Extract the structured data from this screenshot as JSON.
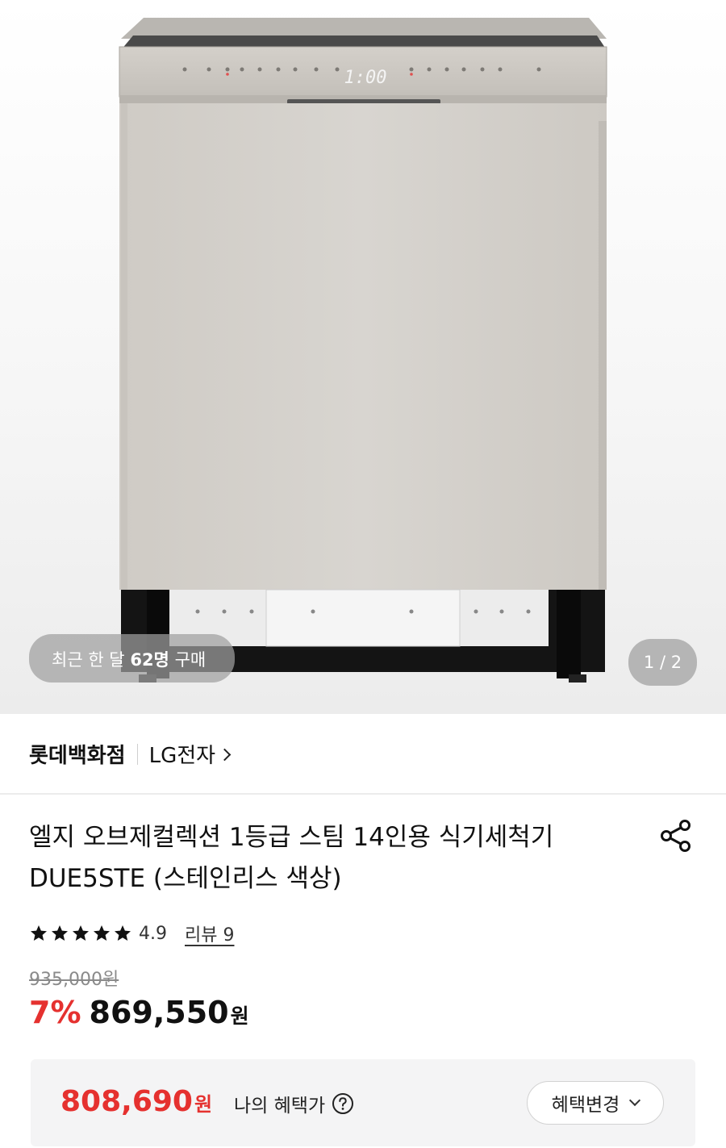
{
  "product_image": {
    "buyers_prefix": "최근 한 달",
    "buyers_count": "62명",
    "buyers_suffix": "구매",
    "pager_current": "1",
    "pager_sep": "/",
    "pager_total": "2",
    "panel_display": "1:00"
  },
  "seller": {
    "store": "롯데백화점",
    "brand": "LG전자"
  },
  "product": {
    "title_line1": "엘지 오브제컬렉션 1등급 스팀 14인용 식기세척기",
    "title_line2": "DUE5STE (스테인리스 색상)",
    "rating_stars": 5,
    "rating": "4.9",
    "review_label": "리뷰 9"
  },
  "price": {
    "original": "935,000원",
    "discount": "7%",
    "sale": "869,550",
    "unit": "원"
  },
  "benefit": {
    "price": "808,690",
    "unit": "원",
    "label": "나의 혜택가",
    "change_button": "혜택변경"
  },
  "icons": {
    "share": "share-icon",
    "help": "question-icon",
    "star": "star-icon",
    "brand_link": "chevron-right-icon",
    "dropdown": "chevron-down-icon"
  },
  "colors": {
    "accent": "#e5312f",
    "benefit_bg": "#f4f4f5"
  }
}
